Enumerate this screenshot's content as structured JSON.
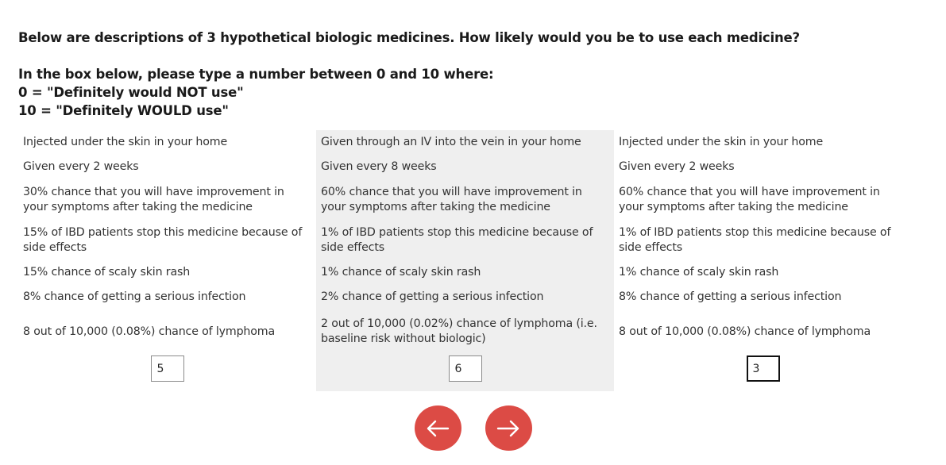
{
  "question": {
    "line1": "Below are descriptions of 3 hypothetical biologic medicines. How likely would you be to use each medicine?",
    "line2": "In the box below, please type a number between 0 and 10 where:",
    "line3": "0 = \"Definitely would NOT use\"",
    "line4": "10 = \"Definitely WOULD use\""
  },
  "options": [
    {
      "route": "Injected under the skin in your home",
      "frequency": "Given every 2 weeks",
      "improvement": "30% chance that you will have improvement in your symptoms after taking the medicine",
      "discontinue": "15% of IBD patients stop this medicine because of side effects",
      "rash": "15% chance of scaly skin rash",
      "infection": "8% chance of getting a serious infection",
      "lymphoma": "8 out of 10,000 (0.08%) chance of lymphoma",
      "rating": "5"
    },
    {
      "route": "Given through an IV into the vein in your home",
      "frequency": "Given every 8 weeks",
      "improvement": "60% chance that you will have improvement in your symptoms after taking the medicine",
      "discontinue": "1% of IBD patients stop this medicine because of side effects",
      "rash": "1% chance of scaly skin rash",
      "infection": "2% chance of getting a serious infection",
      "lymphoma": "2 out of 10,000 (0.02%) chance of lymphoma (i.e. baseline risk without biologic)",
      "rating": "6"
    },
    {
      "route": "Injected under the skin in your home",
      "frequency": "Given every 2 weeks",
      "improvement": "60% chance that you will have improvement in your symptoms after taking the medicine",
      "discontinue": "1% of IBD patients stop this medicine because of side effects",
      "rash": "1% chance of scaly skin rash",
      "infection": "8% chance of getting a serious infection",
      "lymphoma": "8 out of 10,000 (0.08%) chance of lymphoma",
      "rating": "3"
    }
  ],
  "nav": {
    "back_icon": "arrow-left-icon",
    "next_icon": "arrow-right-icon",
    "button_color": "#dc4b45"
  },
  "colors": {
    "shaded_column": "#efefef"
  }
}
